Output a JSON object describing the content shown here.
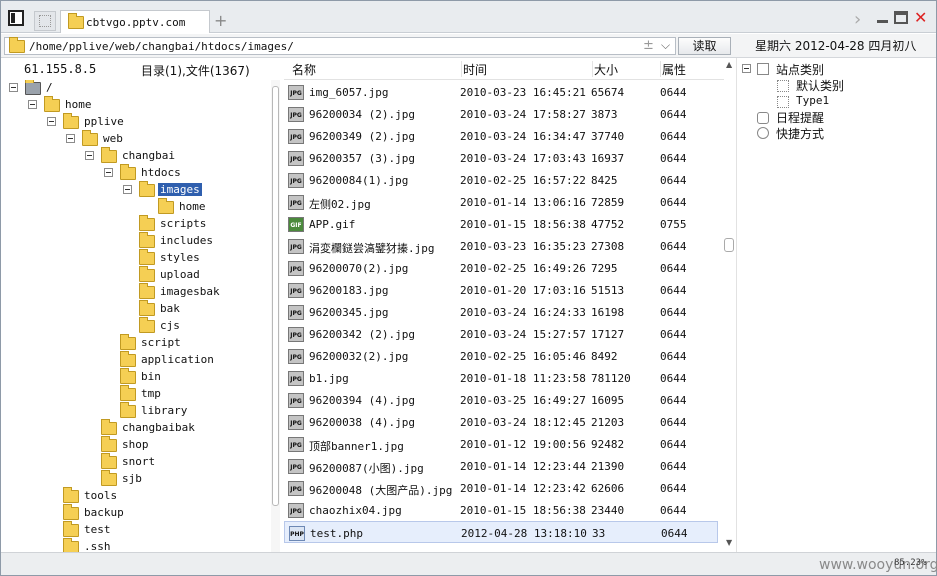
{
  "tab": {
    "title": "cbtvgo.pptv.com"
  },
  "address": {
    "path": "/home/pplive/web/changbai/htdocs/images/",
    "read_button": "读取",
    "date_text": "星期六 2012-04-28 四月初八"
  },
  "left": {
    "ip": "61.155.8.5",
    "count": "目录(1),文件(1367)"
  },
  "tree": [
    "/",
    "home",
    "pplive",
    "web",
    "changbai",
    "htdocs",
    "images",
    "home",
    "scripts",
    "includes",
    "styles",
    "upload",
    "imagesbak",
    "bak",
    "cjs",
    "script",
    "application",
    "bin",
    "tmp",
    "library",
    "changbaibak",
    "shop",
    "snort",
    "sjb",
    "tools",
    "backup",
    "test",
    ".ssh"
  ],
  "columns": {
    "name": "名称",
    "time": "时间",
    "size": "大小",
    "attr": "属性"
  },
  "files": [
    {
      "icon": "JPG",
      "name": "img_6057.jpg",
      "time": "2010-03-23 16:45:21",
      "size": "65674",
      "attr": "0644"
    },
    {
      "icon": "JPG",
      "name": "96200034 (2).jpg",
      "time": "2010-03-24 17:58:27",
      "size": "3873",
      "attr": "0644"
    },
    {
      "icon": "JPG",
      "name": "96200349 (2).jpg",
      "time": "2010-03-24 16:34:47",
      "size": "37740",
      "attr": "0644"
    },
    {
      "icon": "JPG",
      "name": "96200357 (3).jpg",
      "time": "2010-03-24 17:03:43",
      "size": "16937",
      "attr": "0644"
    },
    {
      "icon": "JPG",
      "name": "96200084(1).jpg",
      "time": "2010-02-25 16:57:22",
      "size": "8425",
      "attr": "0644"
    },
    {
      "icon": "JPG",
      "name": "左侧02.jpg",
      "time": "2010-01-14 13:06:16",
      "size": "72859",
      "attr": "0644"
    },
    {
      "icon": "GIF",
      "name": "APP.gif",
      "time": "2010-01-15 18:56:38",
      "size": "47752",
      "attr": "0755"
    },
    {
      "icon": "JPG",
      "name": "涓変欄鎹尝滈鐾犲搸.jpg",
      "time": "2010-03-23 16:35:23",
      "size": "27308",
      "attr": "0644"
    },
    {
      "icon": "JPG",
      "name": "96200070(2).jpg",
      "time": "2010-02-25 16:49:26",
      "size": "7295",
      "attr": "0644"
    },
    {
      "icon": "JPG",
      "name": "96200183.jpg",
      "time": "2010-01-20 17:03:16",
      "size": "51513",
      "attr": "0644"
    },
    {
      "icon": "JPG",
      "name": "96200345.jpg",
      "time": "2010-03-24 16:24:33",
      "size": "16198",
      "attr": "0644"
    },
    {
      "icon": "JPG",
      "name": "96200342 (2).jpg",
      "time": "2010-03-24 15:27:57",
      "size": "17127",
      "attr": "0644"
    },
    {
      "icon": "JPG",
      "name": "96200032(2).jpg",
      "time": "2010-02-25 16:05:46",
      "size": "8492",
      "attr": "0644"
    },
    {
      "icon": "JPG",
      "name": "b1.jpg",
      "time": "2010-01-18 11:23:58",
      "size": "781120",
      "attr": "0644"
    },
    {
      "icon": "JPG",
      "name": "96200394 (4).jpg",
      "time": "2010-03-25 16:49:27",
      "size": "16095",
      "attr": "0644"
    },
    {
      "icon": "JPG",
      "name": "96200038 (4).jpg",
      "time": "2010-03-24 18:12:45",
      "size": "21203",
      "attr": "0644"
    },
    {
      "icon": "JPG",
      "name": "顶部banner1.jpg",
      "time": "2010-01-12 19:00:56",
      "size": "92482",
      "attr": "0644"
    },
    {
      "icon": "JPG",
      "name": "96200087(小图).jpg",
      "time": "2010-01-14 12:23:44",
      "size": "21390",
      "attr": "0644"
    },
    {
      "icon": "JPG",
      "name": "96200048 (大图产品).jpg",
      "time": "2010-01-14 12:23:42",
      "size": "62606",
      "attr": "0644"
    },
    {
      "icon": "JPG",
      "name": "chaozhix04.jpg",
      "time": "2010-01-15 18:56:38",
      "size": "23440",
      "attr": "0644"
    },
    {
      "icon": "PHP",
      "name": "test.php",
      "time": "2012-04-28 13:18:10",
      "size": "33",
      "attr": "0644"
    }
  ],
  "right": {
    "sites": "站点类别",
    "default": "默认类别",
    "type1": "Type1",
    "schedule": "日程提醒",
    "shortcut": "快捷方式"
  },
  "status": {
    "zoom": "85.23%",
    "watermark": "www.wooyun.org"
  }
}
